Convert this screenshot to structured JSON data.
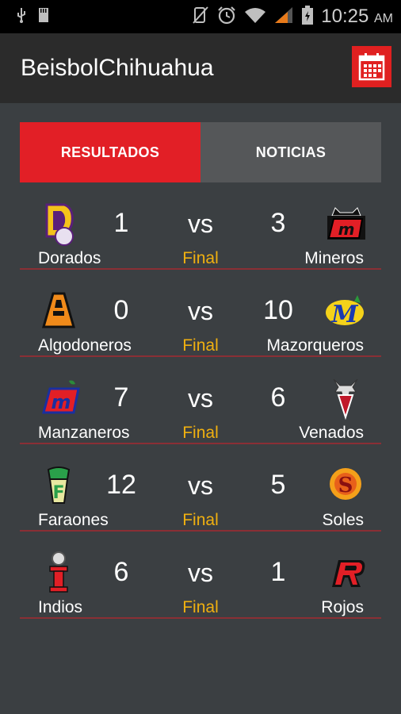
{
  "status_bar": {
    "time": "10:25",
    "ampm": "AM",
    "icons": [
      "usb-icon",
      "sd-card-icon",
      "mute-icon",
      "alarm-icon",
      "wifi-icon",
      "signal-icon",
      "battery-icon"
    ]
  },
  "app_bar": {
    "title": "BeisbolChihuahua",
    "calendar_icon": "calendar-icon"
  },
  "tabs": [
    {
      "label": "RESULTADOS",
      "active": true
    },
    {
      "label": "NOTICIAS",
      "active": false
    }
  ],
  "vs_label": "vs",
  "games": [
    {
      "home": "Dorados",
      "home_score": "1",
      "away": "Mineros",
      "away_score": "3",
      "status": "Final"
    },
    {
      "home": "Algodoneros",
      "home_score": "0",
      "away": "Mazorqueros",
      "away_score": "10",
      "status": "Final"
    },
    {
      "home": "Manzaneros",
      "home_score": "7",
      "away": "Venados",
      "away_score": "6",
      "status": "Final"
    },
    {
      "home": "Faraones",
      "home_score": "12",
      "away": "Soles",
      "away_score": "5",
      "status": "Final"
    },
    {
      "home": "Indios",
      "home_score": "6",
      "away": "Rojos",
      "away_score": "1",
      "status": "Final"
    }
  ],
  "colors": {
    "accent": "#e21f26",
    "final": "#f0b010",
    "background": "#3b3f42",
    "divider": "#8a2f35"
  }
}
